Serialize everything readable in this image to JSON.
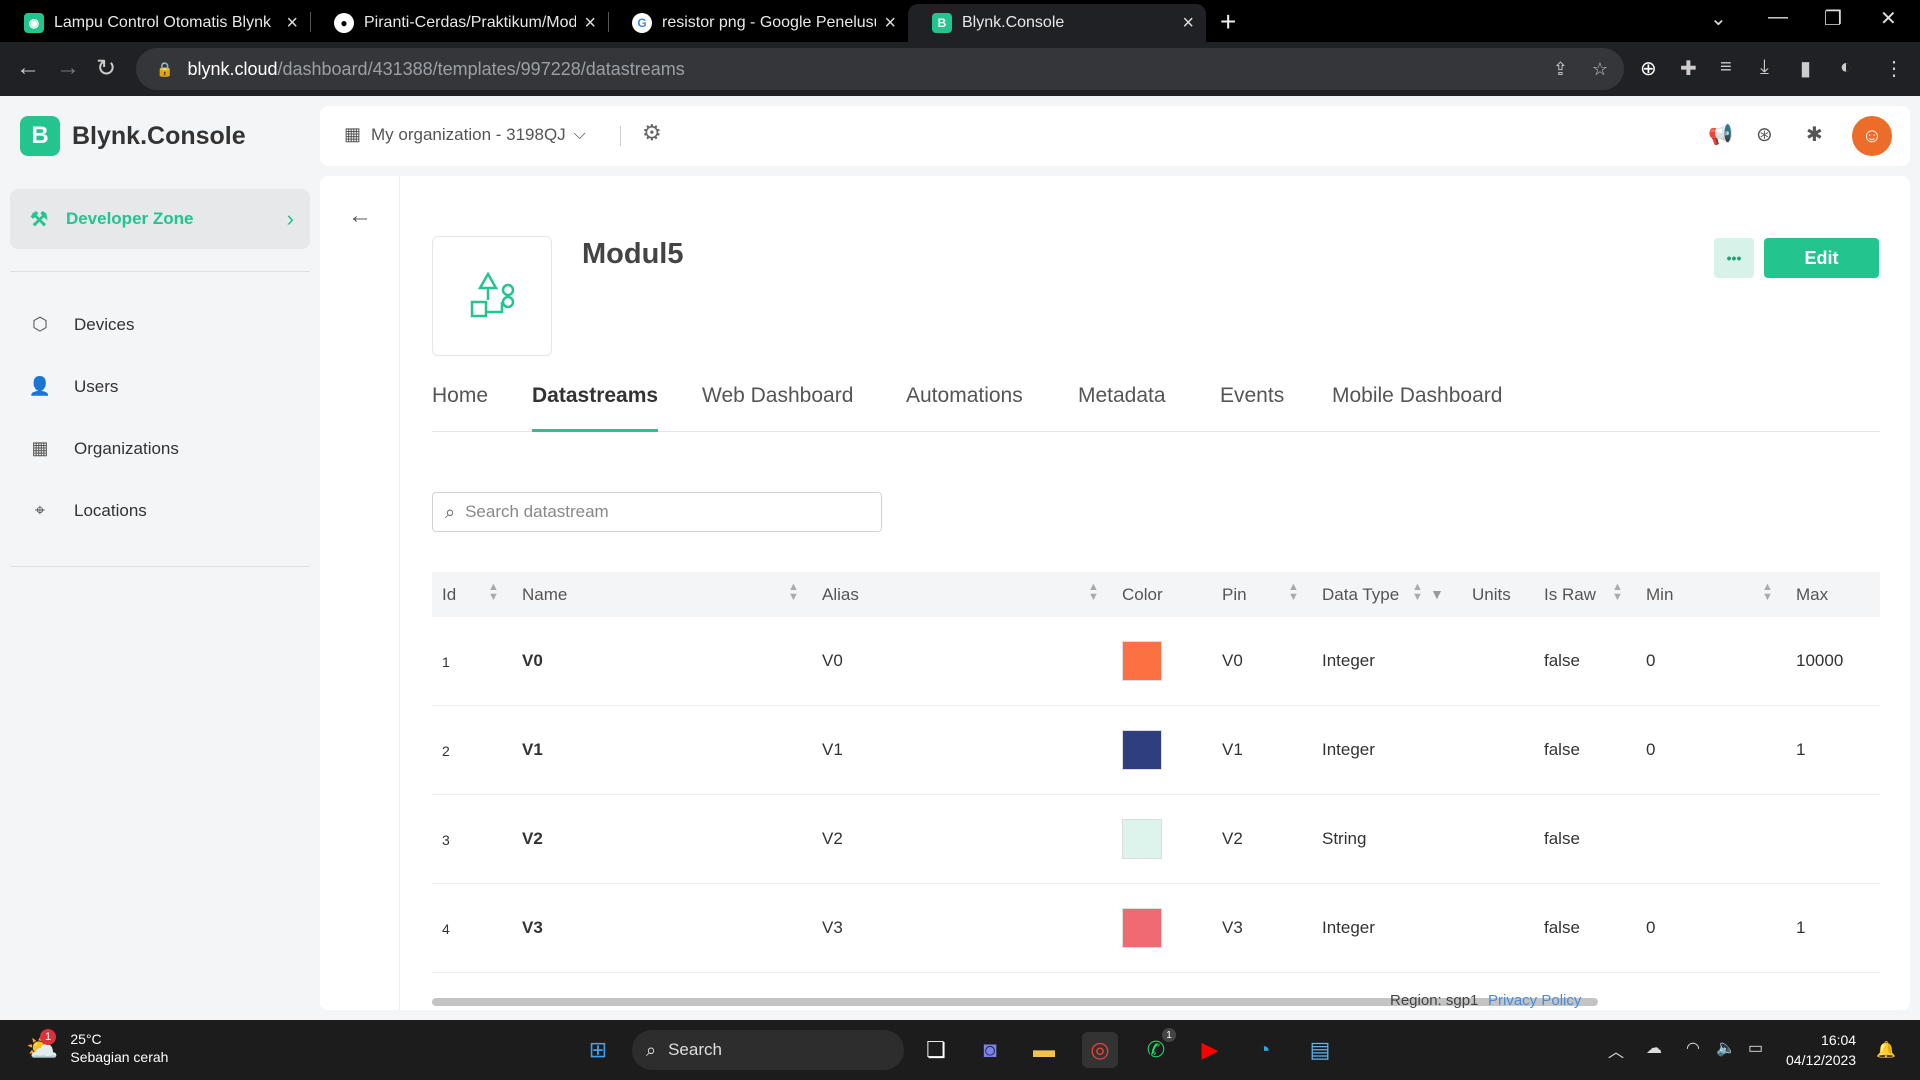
{
  "browser": {
    "tabs": [
      {
        "title": "Lampu Control Otomatis Blynk",
        "favicon": "blynk-icon",
        "active": false
      },
      {
        "title": "Piranti-Cerdas/Praktikum/Modul",
        "favicon": "github-icon",
        "active": false
      },
      {
        "title": "resistor png - Google Penelusuran",
        "favicon": "google-icon",
        "active": false
      },
      {
        "title": "Blynk.Console",
        "favicon": "blynk-icon",
        "active": true
      }
    ],
    "url_host": "blynk.cloud",
    "url_path": "/dashboard/431388/templates/997228/datastreams"
  },
  "app": {
    "brand": "Blynk.Console",
    "brand_letter": "B",
    "accent_color": "#23c48e",
    "organization": "My organization - 3198QJ"
  },
  "sidebar": {
    "developer_zone": "Developer Zone",
    "items": [
      {
        "label": "Devices",
        "icon": "cube-icon"
      },
      {
        "label": "Users",
        "icon": "users-icon"
      },
      {
        "label": "Organizations",
        "icon": "building-icon"
      },
      {
        "label": "Locations",
        "icon": "pin-icon"
      }
    ]
  },
  "template": {
    "name": "Modul5",
    "more_label": "•••",
    "edit_label": "Edit"
  },
  "page_tabs": [
    {
      "label": "Home",
      "active": false
    },
    {
      "label": "Datastreams",
      "active": true
    },
    {
      "label": "Web Dashboard",
      "active": false
    },
    {
      "label": "Automations",
      "active": false
    },
    {
      "label": "Metadata",
      "active": false
    },
    {
      "label": "Events",
      "active": false
    },
    {
      "label": "Mobile Dashboard",
      "active": false
    }
  ],
  "search": {
    "placeholder": "Search datastream",
    "value": ""
  },
  "table": {
    "columns": [
      "Id",
      "Name",
      "Alias",
      "Color",
      "Pin",
      "Data Type",
      "Units",
      "Is Raw",
      "Min",
      "Max"
    ],
    "rows": [
      {
        "id": "1",
        "name": "V0",
        "alias": "V0",
        "color": "#fb7141",
        "pin": "V0",
        "data_type": "Integer",
        "units": "",
        "is_raw": "false",
        "min": "0",
        "max": "10000"
      },
      {
        "id": "2",
        "name": "V1",
        "alias": "V1",
        "color": "#2f3e7e",
        "pin": "V1",
        "data_type": "Integer",
        "units": "",
        "is_raw": "false",
        "min": "0",
        "max": "1"
      },
      {
        "id": "3",
        "name": "V2",
        "alias": "V2",
        "color": "#dcf4ec",
        "pin": "V2",
        "data_type": "String",
        "units": "",
        "is_raw": "false",
        "min": "",
        "max": ""
      },
      {
        "id": "4",
        "name": "V3",
        "alias": "V3",
        "color": "#ef6a72",
        "pin": "V3",
        "data_type": "Integer",
        "units": "",
        "is_raw": "false",
        "min": "0",
        "max": "1"
      }
    ]
  },
  "footer": {
    "region": "Region: sgp1",
    "privacy": "Privacy Policy"
  },
  "taskbar": {
    "weather_temp": "25°C",
    "weather_desc": "Sebagian cerah",
    "weather_badge": "1",
    "search_label": "Search",
    "whatsapp_badge": "1",
    "time": "16:04",
    "date": "04/12/2023"
  }
}
